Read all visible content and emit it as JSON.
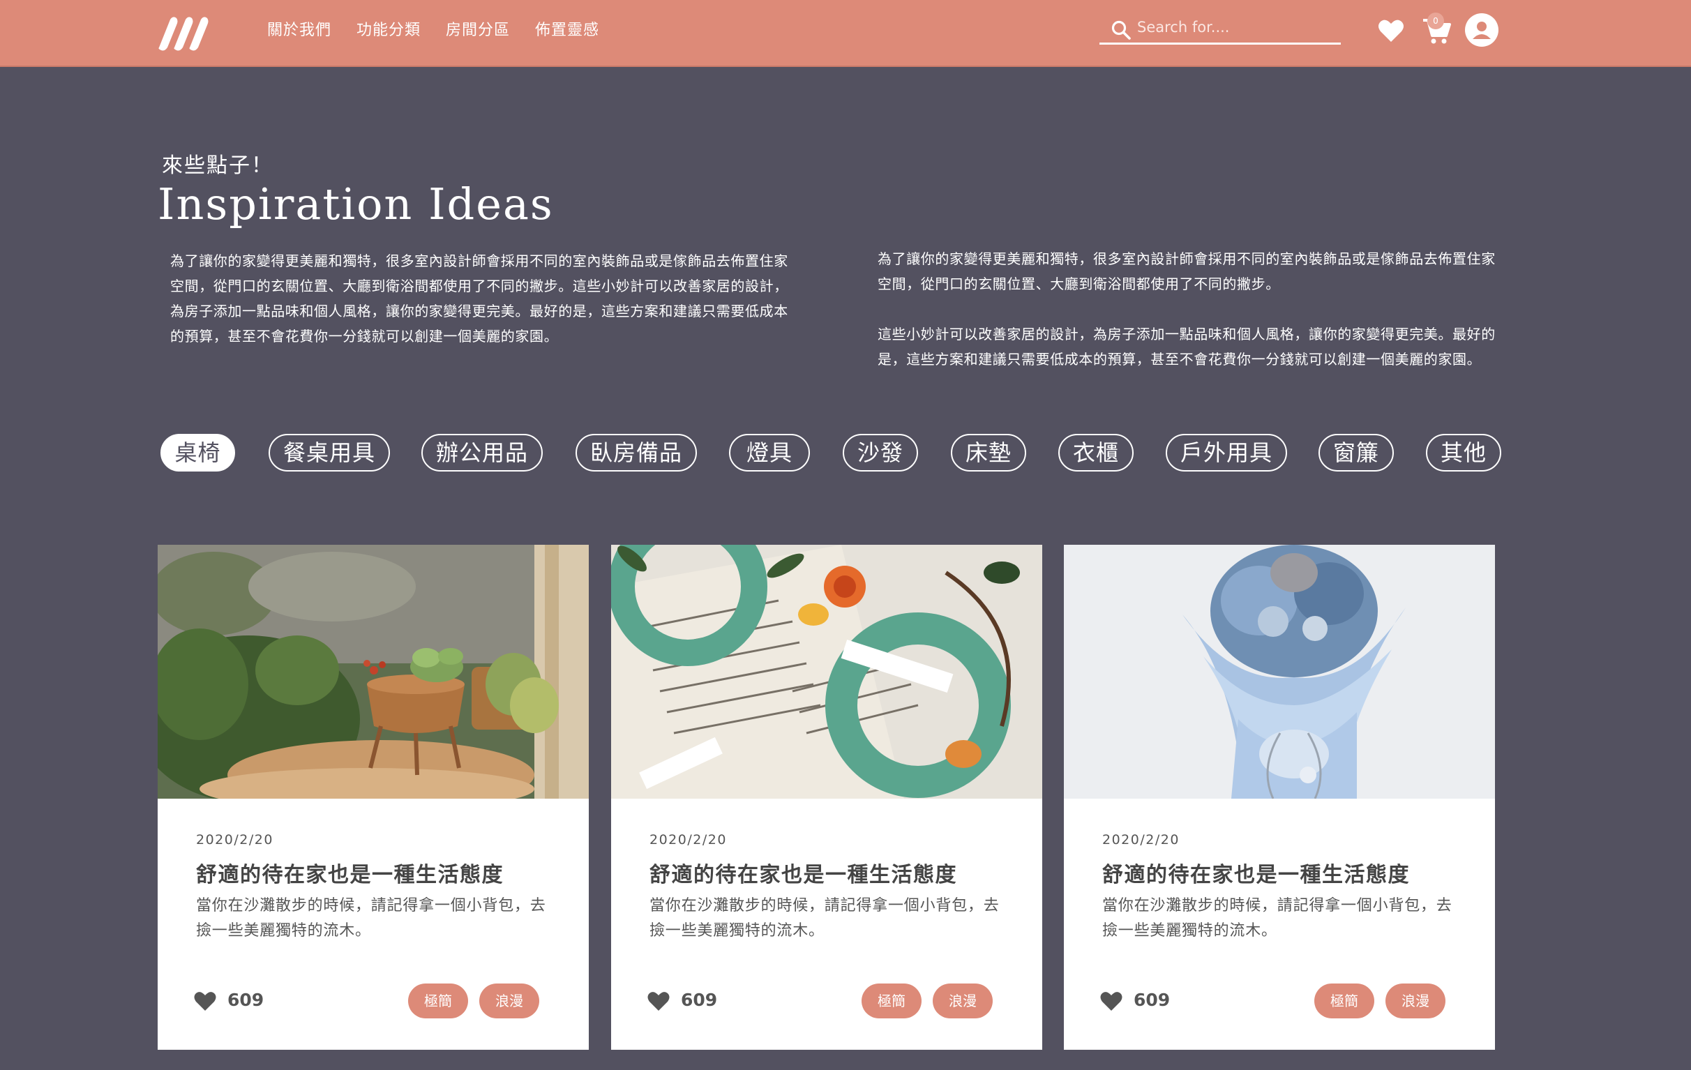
{
  "header": {
    "nav": [
      "關於我們",
      "功能分類",
      "房間分區",
      "佈置靈感"
    ],
    "search_placeholder": "Search for....",
    "cart_count": "0"
  },
  "hero": {
    "eyebrow": "來些點子！",
    "title": "Inspiration Ideas",
    "intro_left": "為了讓你的家變得更美麗和獨特，很多室內設計師會採用不同的室內裝飾品或是傢飾品去佈置住家空間，從門口的玄關位置、大廳到衛浴間都使用了不同的撇步。這些小妙計可以改善家居的設計，為房子添加一點品味和個人風格，讓你的家變得更完美。最好的是，這些方案和建議只需要低成本的預算，甚至不會花費你一分錢就可以創建一個美麗的家園。",
    "intro_right_1": "為了讓你的家變得更美麗和獨特，很多室內設計師會採用不同的室內裝飾品或是傢飾品去佈置住家空間，從門口的玄關位置、大廳到衛浴間都使用了不同的撇步。",
    "intro_right_2": "這些小妙計可以改善家居的設計，為房子添加一點品味和個人風格，讓你的家變得更完美。最好的是，這些方案和建議只需要低成本的預算，甚至不會花費你一分錢就可以創建一個美麗的家園。"
  },
  "categories": [
    "桌椅",
    "餐桌用具",
    "辦公用品",
    "臥房備品",
    "燈具",
    "沙發",
    "床墊",
    "衣櫃",
    "戶外用具",
    "窗簾",
    "其他"
  ],
  "cards": [
    {
      "date": "2020/2/20",
      "title": "舒適的待在家也是一種生活態度",
      "desc": "當你在沙灘散步的時候，請記得拿一個小背包，去撿一些美麗獨特的流木。",
      "likes": "609",
      "tags": [
        "極簡",
        "浪漫"
      ]
    },
    {
      "date": "2020/2/20",
      "title": "舒適的待在家也是一種生活態度",
      "desc": "當你在沙灘散步的時候，請記得拿一個小背包，去撿一些美麗獨特的流木。",
      "likes": "609",
      "tags": [
        "極簡",
        "浪漫"
      ]
    },
    {
      "date": "2020/2/20",
      "title": "舒適的待在家也是一種生活態度",
      "desc": "當你在沙灘散步的時候，請記得拿一個小背包，去撿一些美麗獨特的流木。",
      "likes": "609",
      "tags": [
        "極簡",
        "浪漫"
      ]
    }
  ],
  "colors": {
    "header": "#dd8a78",
    "background": "#535160",
    "accent": "#dd8a78",
    "card": "#ffffff"
  }
}
